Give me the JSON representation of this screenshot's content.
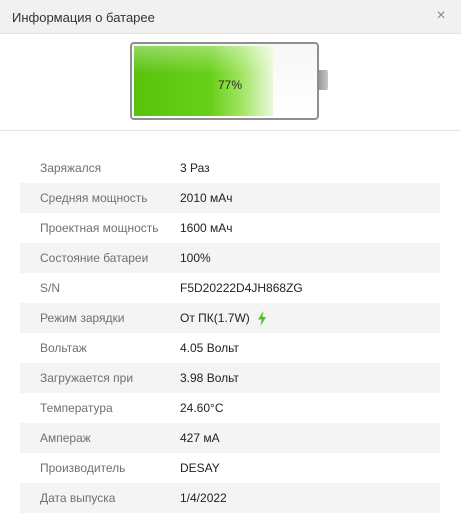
{
  "window": {
    "title": "Информация о батарее",
    "close_glyph": "×"
  },
  "battery": {
    "level_percent": 77,
    "percent_text": "77%",
    "fill_color": "#5cc70e"
  },
  "rows": [
    {
      "label": "Заряжался",
      "value": "3 Раз"
    },
    {
      "label": "Средняя мощность",
      "value": "2010 мАч"
    },
    {
      "label": "Проектная мощность",
      "value": "1600 мАч"
    },
    {
      "label": "Состояние батареи",
      "value": "100%"
    },
    {
      "label": "S/N",
      "value": "F5D20222D4JH868ZG"
    },
    {
      "label": "Режим зарядки",
      "value": "От ПК(1.7W)",
      "icon": "lightning-bolt-icon"
    },
    {
      "label": "Вольтаж",
      "value": "4.05 Вольт"
    },
    {
      "label": "Загружается при",
      "value": "3.98 Вольт"
    },
    {
      "label": "Температура",
      "value": "24.60°C"
    },
    {
      "label": "Ампераж",
      "value": "427 мА"
    },
    {
      "label": "Производитель",
      "value": "DESAY"
    },
    {
      "label": "Дата выпуска",
      "value": "1/4/2022"
    }
  ],
  "colors": {
    "accent_green": "#4cbf2a",
    "row_alt": "#f4f4f4"
  }
}
